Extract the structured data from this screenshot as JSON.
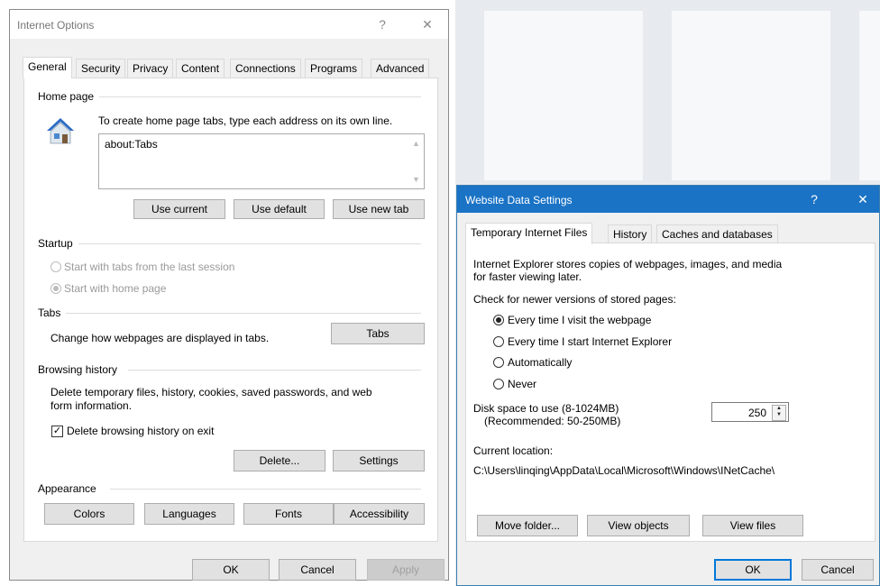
{
  "internet_options": {
    "title": "Internet Options",
    "help": "?",
    "close": "✕",
    "tabs": [
      "General",
      "Security",
      "Privacy",
      "Content",
      "Connections",
      "Programs",
      "Advanced"
    ],
    "home_page": {
      "label": "Home page",
      "description": "To create home page tabs, type each address on its own line.",
      "value": "about:Tabs",
      "buttons": {
        "use_current": "Use current",
        "use_default": "Use default",
        "use_new_tab": "Use new tab"
      }
    },
    "startup": {
      "label": "Startup",
      "options": [
        "Start with tabs from the last session",
        "Start with home page"
      ]
    },
    "tabs_group": {
      "label": "Tabs",
      "description": "Change how webpages are displayed in tabs.",
      "button": "Tabs"
    },
    "browsing_history": {
      "label": "Browsing history",
      "description_line1": "Delete temporary files, history, cookies, saved passwords, and web",
      "description_line2": "form information.",
      "checkbox": "Delete browsing history on exit",
      "delete_button": "Delete...",
      "settings_button": "Settings"
    },
    "appearance": {
      "label": "Appearance",
      "buttons": {
        "colors": "Colors",
        "languages": "Languages",
        "fonts": "Fonts",
        "accessibility": "Accessibility"
      }
    },
    "footer": {
      "ok": "OK",
      "cancel": "Cancel",
      "apply": "Apply"
    }
  },
  "website_data": {
    "title": "Website Data Settings",
    "help": "?",
    "close": "✕",
    "tabs": [
      "Temporary Internet Files",
      "History",
      "Caches and databases"
    ],
    "description_line1": "Internet Explorer stores copies of webpages, images, and media",
    "description_line2": "for faster viewing later.",
    "check_label": "Check for newer versions of stored pages:",
    "options": [
      "Every time I visit the webpage",
      "Every time I start Internet Explorer",
      "Automatically",
      "Never"
    ],
    "disk_label_line1": "Disk space to use (8-1024MB)",
    "disk_label_line2": "(Recommended: 50-250MB)",
    "disk_value": "250",
    "location_label": "Current location:",
    "location_path": "C:\\Users\\linqing\\AppData\\Local\\Microsoft\\Windows\\INetCache\\",
    "buttons": {
      "move_folder": "Move folder...",
      "view_objects": "View objects",
      "view_files": "View files"
    },
    "footer": {
      "ok": "OK",
      "cancel": "Cancel"
    }
  },
  "colors": {
    "title_bar": "#1a73c5",
    "accent": "#0078d7"
  }
}
